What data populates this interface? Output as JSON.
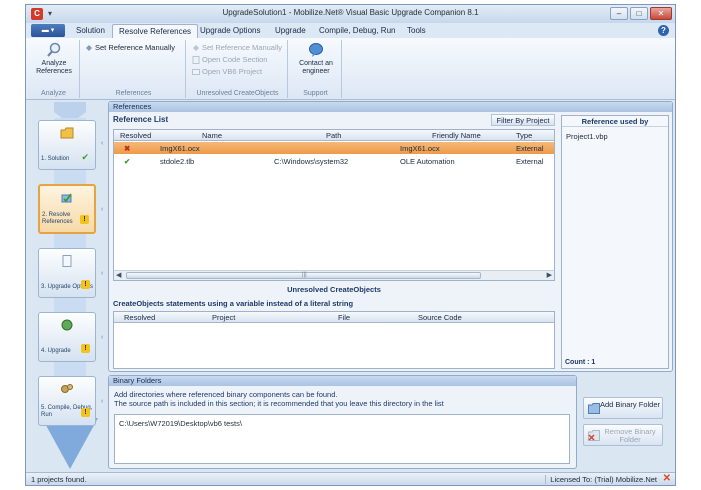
{
  "window": {
    "title": "UpgradeSolution1 - Mobilize.Net® Visual Basic Upgrade Companion 8.1",
    "min_label": "–",
    "max_label": "□",
    "close_label": "✕"
  },
  "menu": {
    "file_glyph": "▾",
    "tabs": [
      "Solution",
      "Resolve References",
      "Upgrade Options",
      "Upgrade",
      "Compile, Debug, Run",
      "Tools"
    ],
    "active_tab": "Resolve References",
    "help_glyph": "?"
  },
  "ribbon": {
    "groups": [
      {
        "label": "Analyze",
        "buttons": [
          {
            "label": "Analyze References",
            "icon": "magnifier-icon"
          }
        ]
      },
      {
        "label": "References",
        "buttons": [
          {
            "label": "Set Reference Manually",
            "icon": "set-reference-icon"
          }
        ]
      },
      {
        "label": "Unresolved CreateObjects",
        "buttons": [
          {
            "label": "Set Reference Manually",
            "disabled": true
          },
          {
            "label": "Open Code Section",
            "disabled": true
          },
          {
            "label": "Open VB6 Project",
            "disabled": true
          }
        ]
      },
      {
        "label": "Support",
        "buttons": [
          {
            "label": "Contact an engineer",
            "icon": "chat-bubble-icon"
          }
        ]
      }
    ]
  },
  "workflow": {
    "steps": [
      {
        "label": "1. Solution",
        "status": "check"
      },
      {
        "label": "2. Resolve References",
        "status": "warning",
        "selected": true
      },
      {
        "label": "3. Upgrade Options",
        "status": "warning"
      },
      {
        "label": "4. Upgrade",
        "status": "warning"
      },
      {
        "label": "5. Compile, Debug, Run",
        "status": "warning"
      }
    ],
    "warning_glyph": "!",
    "check_glyph": "✔"
  },
  "references": {
    "panel_title": "References",
    "list_title": "Reference List",
    "filter_button": "Filter By Project",
    "columns": [
      "Resolved",
      "Name",
      "Path",
      "Friendly Name",
      "Type"
    ],
    "rows": [
      {
        "resolved": "✖",
        "name": "ImgX61.ocx",
        "path": "",
        "friendly_name": "ImgX61.ocx",
        "type": "External",
        "selected": true
      },
      {
        "resolved": "✔",
        "name": "stdole2.tlb",
        "path": "C:\\Windows\\system32",
        "friendly_name": "OLE Automation",
        "type": "External",
        "selected": false
      }
    ],
    "scroll_left": "◀",
    "scroll_right": "▶",
    "scroll_grip": "|||",
    "unresolved_title": "Unresolved CreateObjects",
    "unresolved_desc": "CreateObjects statements using a variable instead of a literal string",
    "unresolved_columns": [
      "Resolved",
      "Project",
      "File",
      "Source Code"
    ],
    "used_by_title": "Reference used by",
    "used_by_items": [
      "Project1.vbp"
    ],
    "count_label": "Count : 1"
  },
  "binary": {
    "panel_title": "Binary Folders",
    "desc_line1": "Add directories where referenced binary components can be found.",
    "desc_line2": "The source path is included in this section; it is recommended that you leave this directory in the list",
    "folders": [
      "C:\\Users\\W72019\\Desktop\\vb6 tests\\"
    ],
    "add_button": "Add Binary Folder",
    "remove_button": "Remove Binary Folder"
  },
  "status": {
    "left": "1 projects found.",
    "right": "Licensed To: (Trial) Mobilize.Net",
    "close_glyph": "✕"
  },
  "colors": {
    "accent": "#2a5394",
    "selected_row": "#ee9a47",
    "warning": "#f2c31c",
    "ok": "#3a9b2e",
    "error": "#d9462b"
  }
}
